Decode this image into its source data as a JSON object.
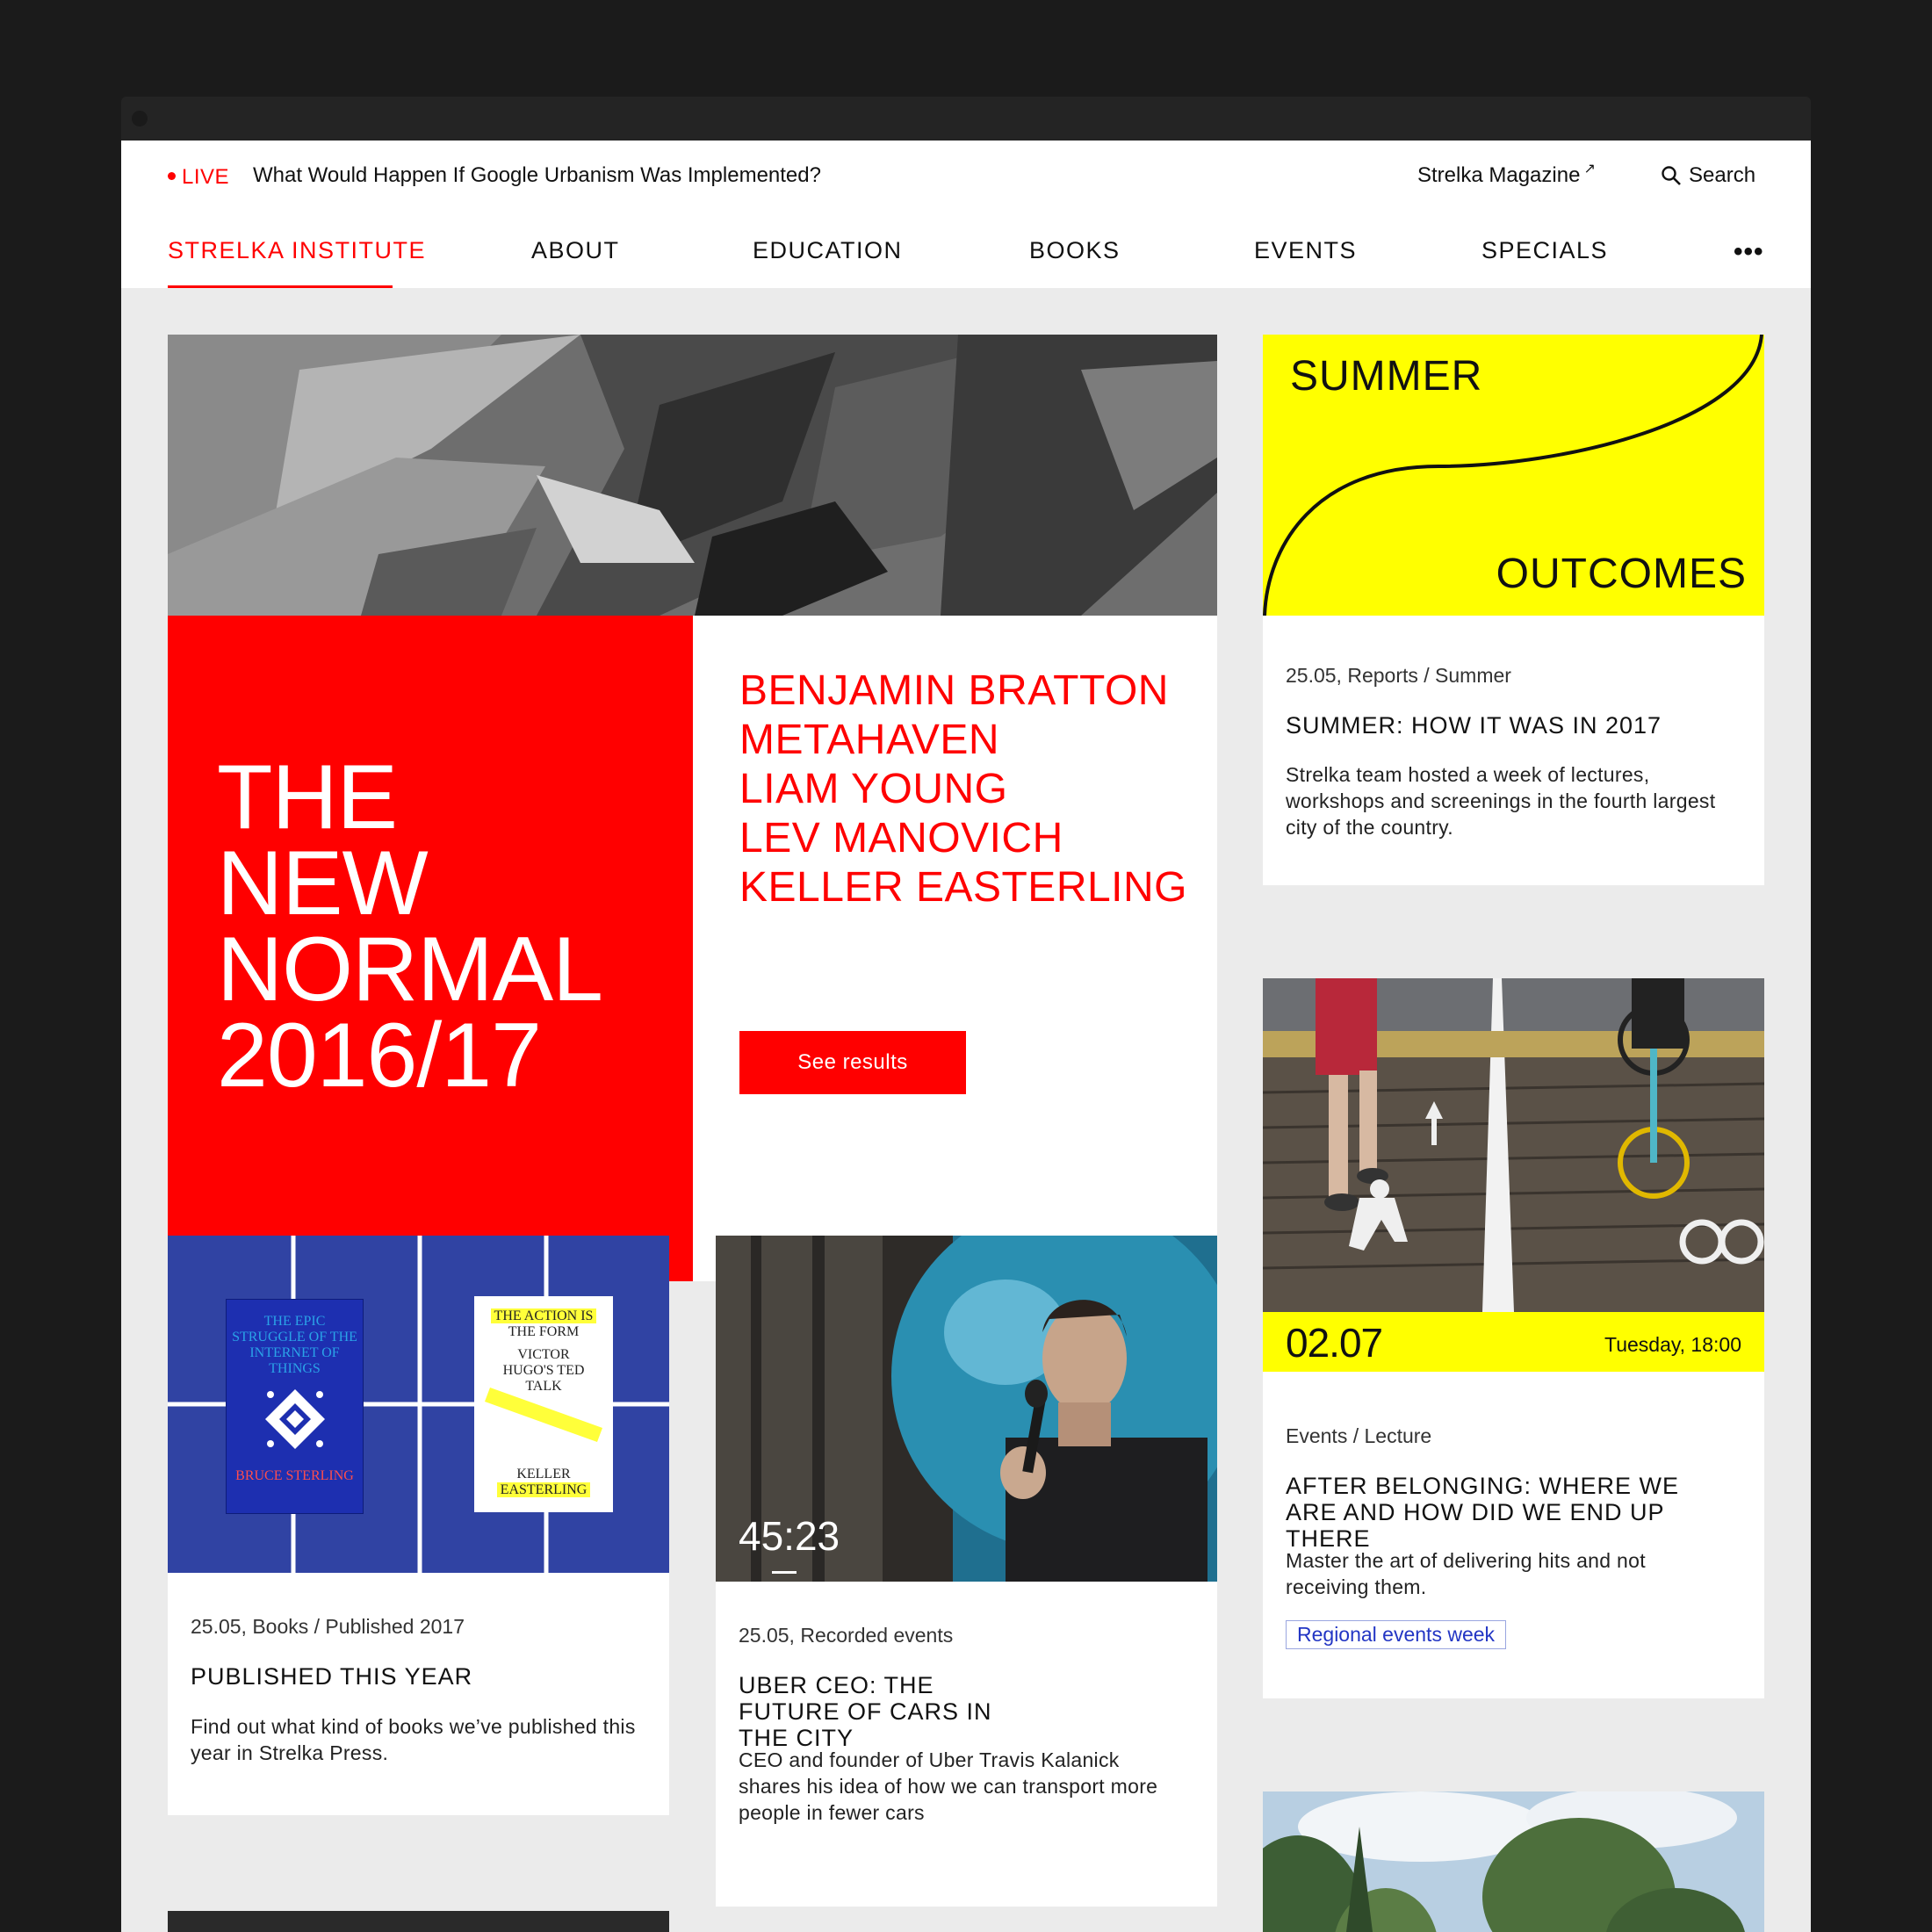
{
  "topbar": {
    "live_label": "LIVE",
    "live_headline": "What Would Happen If Google Urbanism Was Implemented?",
    "magazine_link": "Strelka Magazine",
    "search_label": "Search"
  },
  "nav": {
    "items": [
      "STRELKA INSTITUTE",
      "ABOUT",
      "EDUCATION",
      "BOOKS",
      "EVENTS",
      "SPECIALS"
    ],
    "more": "•••",
    "active_color": "#ff0000"
  },
  "hero": {
    "title_lines": [
      "THE",
      "NEW",
      "NORMAL",
      "2016/17"
    ],
    "names": [
      "BENJAMIN BRATTON",
      "METAHAVEN",
      "LIAM YOUNG",
      "LEV MANOVICH",
      "KELLER EASTERLING"
    ],
    "button": "See results"
  },
  "summer": {
    "img_top": "SUMMER",
    "img_bottom": "OUTCOMES",
    "meta": "25.05, Reports / Summer",
    "title": "SUMMER: HOW IT WAS IN 2017",
    "text": "Strelka team hosted a week of lectures, workshops and screenings in the fourth largest city of the country."
  },
  "books": {
    "book1_title": "THE EPIC STRUGGLE OF THE INTERNET OF THINGS",
    "book1_author": "BRUCE STERLING",
    "book2_title_hl": "THE ACTION IS",
    "book2_title_rest": "THE FORM",
    "book2_subtitle": "VICTOR HUGO'S TED TALK",
    "book2_author_1": "KELLER",
    "book2_author_2": "EASTERLING",
    "meta": "25.05, Books / Published 2017",
    "title": "PUBLISHED THIS YEAR",
    "text": "Find out what kind of books we’ve published this year in Strelka Press."
  },
  "video": {
    "duration": "45:23",
    "meta": "25.05, Recorded events",
    "title": "UBER CEO: THE FUTURE OF CARS IN THE CITY",
    "text": "CEO and founder of Uber Travis Kalanick shares his idea of how we can transport more people in fewer cars"
  },
  "event": {
    "date": "02.07",
    "time": "Tuesday, 18:00",
    "meta": "Events / Lecture",
    "title": "AFTER BELONGING: WHERE WE ARE AND HOW DID WE END UP THERE",
    "text": "Master the art of delivering hits and not receiving them.",
    "tag": "Regional events week"
  },
  "colors": {
    "brand_red": "#ff0000",
    "accent_yellow": "#ffff00",
    "tag_blue": "#2336c4"
  }
}
